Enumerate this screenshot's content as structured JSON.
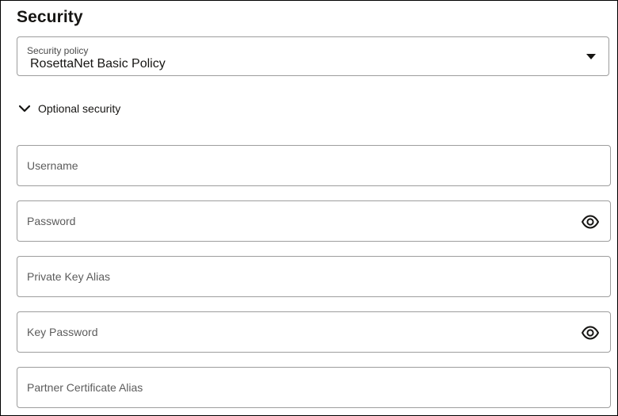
{
  "section": {
    "title": "Security"
  },
  "security_policy": {
    "label": "Security policy",
    "value": "RosettaNet Basic Policy",
    "icon": "caret-down-icon"
  },
  "optional_security": {
    "label": "Optional security",
    "icon": "chevron-down-icon",
    "expanded": true
  },
  "fields": {
    "username": {
      "placeholder": "Username",
      "value": ""
    },
    "password": {
      "placeholder": "Password",
      "value": "",
      "icon": "eye-icon"
    },
    "private_key_alias": {
      "placeholder": "Private Key Alias",
      "value": ""
    },
    "key_password": {
      "placeholder": "Key Password",
      "value": "",
      "icon": "eye-icon"
    },
    "partner_certificate_alias": {
      "placeholder": "Partner Certificate Alias",
      "value": ""
    }
  },
  "colors": {
    "text": "#161513",
    "border": "#9d9d9d",
    "placeholder": "#5c5c5c"
  }
}
